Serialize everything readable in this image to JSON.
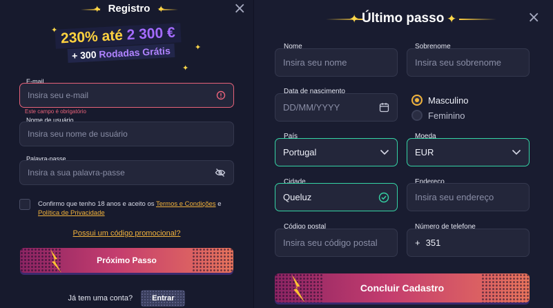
{
  "left": {
    "title": "Registro",
    "bonus_line1_a": "230% até ",
    "bonus_line1_b": "2 300 €",
    "bonus_line2_a": "+ 300 ",
    "bonus_line2_b": "Rodadas Grátis",
    "email": {
      "label": "E-mail",
      "placeholder": "Insira seu e-mail",
      "error": "Este campo é obrigatório"
    },
    "username": {
      "label": "Nome de usuário",
      "placeholder": "Insira seu nome de usuário"
    },
    "password": {
      "label": "Palavra-passe",
      "placeholder": "Insira a sua palavra-passe"
    },
    "terms_text1": "Confirmo que tenho 18 anos e aceito os ",
    "terms_link1": "Termos e Condições",
    "terms_text2": " e ",
    "terms_link2": "Política de Privacidade",
    "promo_link": "Possui um código promocional?",
    "next_button": "Próximo Passo",
    "have_account": "Já tem uma conta?",
    "login_button": "Entrar"
  },
  "right": {
    "title": "Último passo",
    "first_name": {
      "label": "Nome",
      "placeholder": "Insira seu nome"
    },
    "last_name": {
      "label": "Sobrenome",
      "placeholder": "Insira seu sobrenome"
    },
    "birth_date": {
      "label": "Data de nascimento",
      "placeholder": "DD/MM/YYYY"
    },
    "gender": {
      "male": "Masculino",
      "female": "Feminino",
      "selected": "Masculino"
    },
    "country": {
      "label": "País",
      "value": "Portugal"
    },
    "currency": {
      "label": "Moeda",
      "value": "EUR"
    },
    "city": {
      "label": "Cidade",
      "value": "Queluz"
    },
    "address": {
      "label": "Endereço",
      "placeholder": "Insira seu endereço"
    },
    "postal_code": {
      "label": "Código postal",
      "placeholder": "Insira seu código postal"
    },
    "phone": {
      "label": "Número de telefone",
      "prefix": "+",
      "code": "351"
    },
    "submit_button": "Concluir Cadastro"
  },
  "colors": {
    "accent_gold": "#f3b33c",
    "error": "#e9637a",
    "success": "#35d6a6",
    "purple": "#a46bff"
  }
}
